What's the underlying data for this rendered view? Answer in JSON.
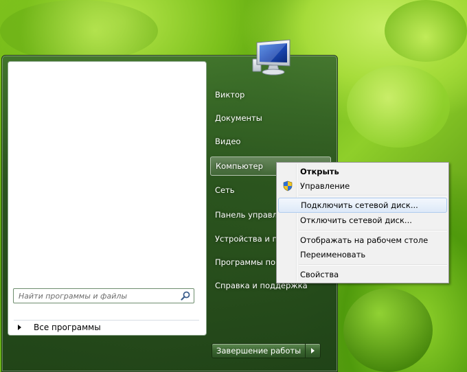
{
  "start_menu": {
    "all_programs_label": "Все программы",
    "search": {
      "placeholder": "Найти программы и файлы",
      "value": ""
    },
    "right_items": [
      {
        "label": "Виктор"
      },
      {
        "label": "Документы"
      },
      {
        "label": "Видео"
      },
      {
        "label": "Компьютер"
      },
      {
        "label": "Сеть"
      },
      {
        "label": "Панель управления"
      },
      {
        "label": "Устройства и принтеры"
      },
      {
        "label": "Программы по умолчанию"
      },
      {
        "label": "Справка и поддержка"
      }
    ],
    "shutdown_label": "Завершение работы"
  },
  "context_menu": {
    "items": [
      {
        "label": "Открыть",
        "bold": true
      },
      {
        "label": "Управление",
        "icon": "uac-shield-icon"
      },
      {
        "label": "Подключить сетевой диск...",
        "hover": true
      },
      {
        "label": "Отключить сетевой диск..."
      },
      {
        "label": "Отображать на рабочем столе"
      },
      {
        "label": "Переименовать"
      },
      {
        "label": "Свойства"
      }
    ]
  },
  "icons": {
    "user_picture": "computer-monitor-icon",
    "search": "magnifier-icon",
    "shutdown_arrow": "triangle-right-icon"
  },
  "colors": {
    "menu_glass": "#2f5a26",
    "context_hover": "#dde9f8",
    "wallpaper_green": "#7fc11c"
  }
}
